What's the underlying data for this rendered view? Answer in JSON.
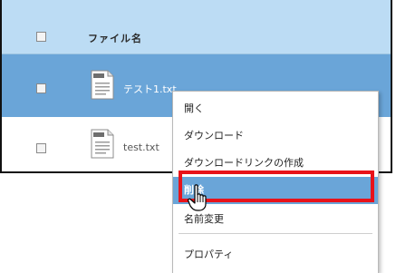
{
  "file_list": {
    "header": {
      "name_column": "ファイル名"
    },
    "rows": [
      {
        "name": "テスト1.txt",
        "selected": true,
        "icon": "text-file-icon"
      },
      {
        "name": "test.txt",
        "selected": false,
        "icon": "text-file-icon"
      }
    ]
  },
  "context_menu": {
    "items": [
      {
        "label": "開く"
      },
      {
        "label": "ダウンロード"
      },
      {
        "label": "ダウンロードリンクの作成"
      },
      {
        "label": "削除",
        "highlighted": true
      },
      {
        "label": "名前変更"
      },
      {
        "label": "プロパティ"
      }
    ]
  },
  "colors": {
    "header_bg": "#bcdcf4",
    "selected_row_bg": "#6aa5d8",
    "menu_highlight_bg": "#6aa5d8",
    "annotation_red": "#e8131a"
  },
  "icons": [
    "checkbox-icon",
    "text-file-icon",
    "hand-cursor-icon"
  ]
}
